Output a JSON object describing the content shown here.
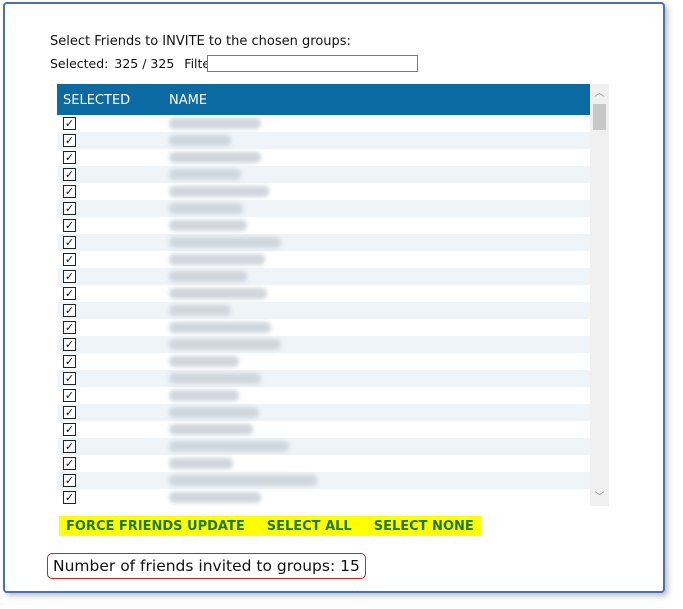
{
  "header": {
    "title": "Select Friends to INVITE to the chosen groups:",
    "selected_label": "Selected:",
    "selected_count": "325 / 325",
    "filter_label": "Filter:",
    "filter_value": ""
  },
  "grid": {
    "columns": [
      "SELECTED",
      "NAME"
    ],
    "check_glyph": "✓",
    "visible_row_count": 23,
    "name_cells": "blurred"
  },
  "scrollbar": {
    "up_icon": "chevron-up-icon",
    "down_icon": "chevron-down-icon"
  },
  "actions": {
    "force_update": "FORCE FRIENDS UPDATE",
    "select_all": "SELECT ALL",
    "select_none": "SELECT NONE",
    "highlight_color": "#ffff00",
    "text_color": "#1a7a1a"
  },
  "footer": {
    "invited_text": "Number of friends invited to groups: 15"
  },
  "colors": {
    "header_bg": "#0b6aa2",
    "alt_row_bg": "#eef4f8",
    "window_border": "#4a6fb3",
    "callout_border": "#d62020"
  }
}
